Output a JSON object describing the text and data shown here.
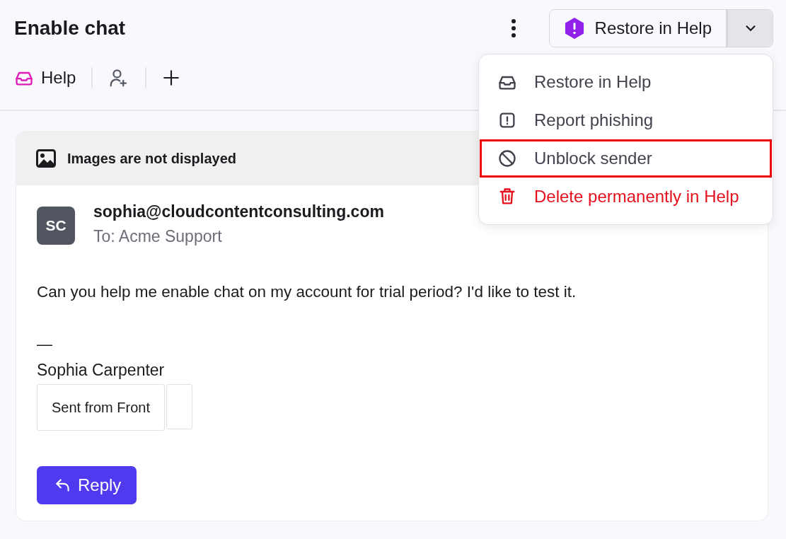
{
  "header": {
    "title": "Enable chat",
    "split_button": {
      "label": "Restore in Help"
    },
    "inbox_tab": {
      "label": "Help"
    }
  },
  "menu": {
    "items": [
      {
        "kind": "inbox",
        "label": "Restore in Help",
        "selected": false
      },
      {
        "kind": "alert",
        "label": "Report phishing",
        "selected": false
      },
      {
        "kind": "block",
        "label": "Unblock sender",
        "selected": true
      },
      {
        "kind": "danger",
        "label": "Delete permanently in Help",
        "selected": false
      }
    ]
  },
  "message": {
    "banner": "Images are not displayed",
    "avatar": "SC",
    "sender": "sophia@cloudcontentconsulting.com",
    "recipient": "To: Acme Support",
    "body": "Can you help me enable chat on my account for trial period? I'd like to test it.",
    "separator": "—",
    "signature": "Sophia Carpenter",
    "signature_table": [
      "Sent from Front"
    ],
    "reply": "Reply"
  }
}
